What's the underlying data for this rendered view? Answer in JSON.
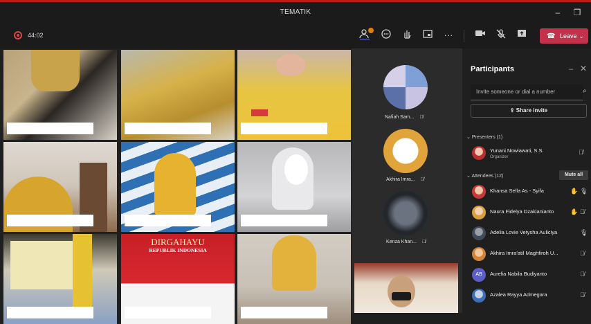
{
  "window": {
    "title": "TEMATIK",
    "minimize": "–",
    "maximize": "❐"
  },
  "toolbar": {
    "timer": "44:02",
    "leave_label": "Leave",
    "icons": [
      "people-icon",
      "chat-icon",
      "raise-hand-icon",
      "rooms-icon",
      "more-icon",
      "camera-icon",
      "mic-off-icon",
      "share-icon"
    ]
  },
  "side": {
    "participants": [
      {
        "name": "Nafiah Sam...",
        "muted": true
      },
      {
        "name": "Akhira Imra...",
        "muted": true
      },
      {
        "name": "Kenza Khan...",
        "muted": true
      }
    ]
  },
  "tiles": {
    "banner_top": "DIRGAHAYU",
    "banner_bottom": "REPUBLIK INDONESIA"
  },
  "panel": {
    "title": "Participants",
    "invite_placeholder": "Invite someone or dial a number",
    "share_invite": "Share invite",
    "presenters_header": "Presenters (1)",
    "attendees_header": "Attendees (12)",
    "mute_all": "Mute all",
    "presenters": [
      {
        "name": "Yunani Nowiawati, S.S.",
        "role": "Organizer"
      }
    ],
    "attendees": [
      {
        "name": "Khansa Sella As - Syifa",
        "hand": true,
        "mic": "on"
      },
      {
        "name": "Naura Fidelya Dzakianianto",
        "hand": true,
        "mic": "off"
      },
      {
        "name": "Adelia Lovie Vetysha Auliciya",
        "hand": false,
        "mic": "on"
      },
      {
        "name": "Akhira Imra'atil Maghfiroh U...",
        "hand": false,
        "mic": "off"
      },
      {
        "name": "Aurelia Nabila Budiyanto",
        "initials": "AB",
        "hand": false,
        "mic": "off"
      },
      {
        "name": "Azalea Rayya Admegara",
        "hand": false,
        "mic": "off"
      }
    ]
  },
  "colors": {
    "accent": "#c4314b",
    "hand": "#f0b400",
    "titlebar_accent": "#c0191b"
  }
}
